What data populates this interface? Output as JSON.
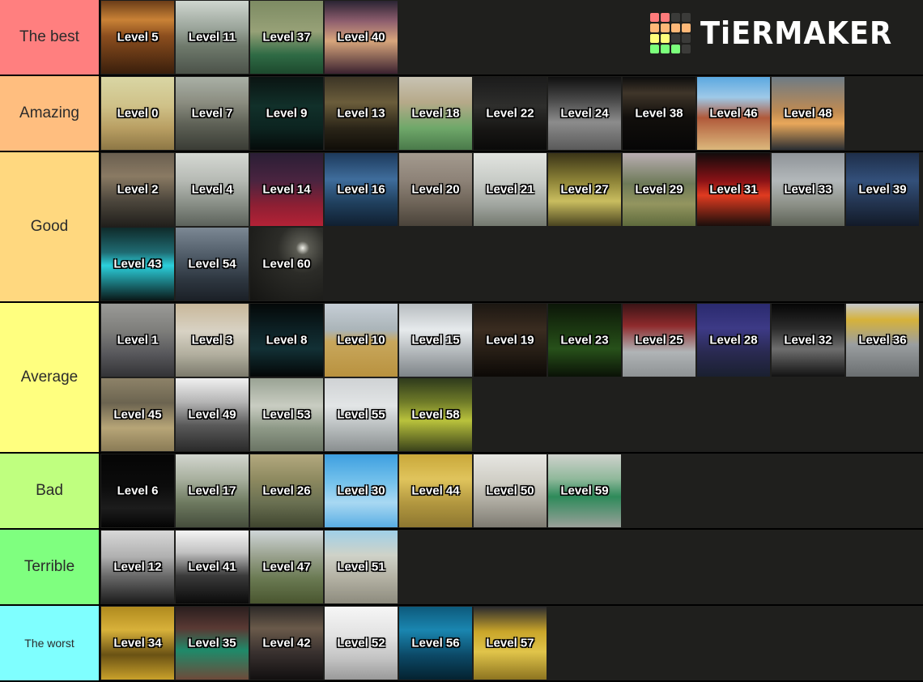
{
  "app": {
    "title": "TierMaker",
    "background_color": "#1f1f1d",
    "logo_text": "TiERMAKER"
  },
  "logo": {
    "cells": [
      "#ff7b7b",
      "#ff7b7b",
      "#3b3b39",
      "#3b3b39",
      "#ffb878",
      "#ffb878",
      "#ffb878",
      "#ffb878",
      "#ffff7b",
      "#ffff7b",
      "#3b3b39",
      "#3b3b39",
      "#7bff7b",
      "#7bff7b",
      "#7bff7b",
      "#3b3b39"
    ]
  },
  "tiers": [
    {
      "label": "The best",
      "color": "#ff7f7f",
      "items": [
        {
          "caption": "Level 5",
          "art": "lobby-warm-wood"
        },
        {
          "caption": "Level 11",
          "art": "empty-city-street"
        },
        {
          "caption": "Level 37",
          "art": "green-pool-room"
        },
        {
          "caption": "Level 40",
          "art": "arcade-cabinets"
        }
      ]
    },
    {
      "label": "Amazing",
      "color": "#ffbe7f",
      "items": [
        {
          "caption": "Level 0",
          "art": "yellow-carpet-rooms"
        },
        {
          "caption": "Level 7",
          "art": "flooded-thrift-store"
        },
        {
          "caption": "Level 9",
          "art": "dark-suburb-night"
        },
        {
          "caption": "Level 13",
          "art": "dim-tunnel-lights"
        },
        {
          "caption": "Level 18",
          "art": "colorful-classroom"
        },
        {
          "caption": "Level 22",
          "art": "dark-warehouse"
        },
        {
          "caption": "Level 24",
          "art": "grey-rocky-surface"
        },
        {
          "caption": "Level 38",
          "art": "dark-window-room"
        },
        {
          "caption": "Level 46",
          "art": "red-desert-arch"
        },
        {
          "caption": "Level 48",
          "art": "ocean-sunset"
        }
      ]
    },
    {
      "label": "Good",
      "color": "#ffd87f",
      "items": [
        {
          "caption": "Level 2",
          "art": "pipe-maintenance-hall"
        },
        {
          "caption": "Level 4",
          "art": "grey-office-floor"
        },
        {
          "caption": "Level 14",
          "art": "red-forest"
        },
        {
          "caption": "Level 16",
          "art": "blue-night-sky"
        },
        {
          "caption": "Level 20",
          "art": "warehouse-shelves"
        },
        {
          "caption": "Level 21",
          "art": "white-corridor-stairs"
        },
        {
          "caption": "Level 27",
          "art": "yellow-cave"
        },
        {
          "caption": "Level 29",
          "art": "country-road-trees"
        },
        {
          "caption": "Level 31",
          "art": "neon-red-club"
        },
        {
          "caption": "Level 33",
          "art": "mall-escalator"
        },
        {
          "caption": "Level 39",
          "art": "blue-dusk-woods"
        },
        {
          "caption": "Level 43",
          "art": "cyan-screen-warehouse"
        },
        {
          "caption": "Level 54",
          "art": "concrete-stairwell"
        },
        {
          "caption": "Level 60",
          "art": "dark-void-lights"
        }
      ]
    },
    {
      "label": "Average",
      "color": "#ffff7f",
      "items": [
        {
          "caption": "Level 1",
          "art": "grey-parking-garage"
        },
        {
          "caption": "Level 3",
          "art": "white-cage-corridor"
        },
        {
          "caption": "Level 8",
          "art": "black-cave-teal"
        },
        {
          "caption": "Level 10",
          "art": "wheat-field-sky"
        },
        {
          "caption": "Level 15",
          "art": "white-tiled-tunnel"
        },
        {
          "caption": "Level 19",
          "art": "dark-wooden-attic"
        },
        {
          "caption": "Level 23",
          "art": "green-night-forest"
        },
        {
          "caption": "Level 25",
          "art": "red-arcade-interior"
        },
        {
          "caption": "Level 28",
          "art": "purple-night-ruin"
        },
        {
          "caption": "Level 32",
          "art": "bw-forest-figures"
        },
        {
          "caption": "Level 36",
          "art": "airport-terminal"
        },
        {
          "caption": "Level 45",
          "art": "tan-office-desk"
        },
        {
          "caption": "Level 49",
          "art": "bw-battlefield"
        },
        {
          "caption": "Level 53",
          "art": "green-kitchen"
        },
        {
          "caption": "Level 55",
          "art": "supermarket-aisle"
        },
        {
          "caption": "Level 58",
          "art": "yellow-factory"
        }
      ]
    },
    {
      "label": "Bad",
      "color": "#bfff7f",
      "items": [
        {
          "caption": "Level 6",
          "art": "pitch-black-room"
        },
        {
          "caption": "Level 17",
          "art": "green-door-hallway"
        },
        {
          "caption": "Level 26",
          "art": "patterned-hotel-hall"
        },
        {
          "caption": "Level 30",
          "art": "blue-sky-clouds"
        },
        {
          "caption": "Level 44",
          "art": "yellow-tile-room"
        },
        {
          "caption": "Level 50",
          "art": "foggy-desert-road"
        },
        {
          "caption": "Level 59",
          "art": "green-subway-tunnel"
        }
      ]
    },
    {
      "label": "Terrible",
      "color": "#7fff7f",
      "items": [
        {
          "caption": "Level 12",
          "art": "grey-test-pattern"
        },
        {
          "caption": "Level 41",
          "art": "bw-wooden-bridge"
        },
        {
          "caption": "Level 47",
          "art": "misty-forest-vines"
        },
        {
          "caption": "Level 51",
          "art": "skylight-stone-hall"
        }
      ]
    },
    {
      "label": "The worst",
      "color": "#7fffff",
      "items": [
        {
          "caption": "Level 34",
          "art": "golden-cave-arch"
        },
        {
          "caption": "Level 35",
          "art": "green-underpass"
        },
        {
          "caption": "Level 42",
          "art": "smoky-dark-sky"
        },
        {
          "caption": "Level 52",
          "art": "snowy-white-forest"
        },
        {
          "caption": "Level 56",
          "art": "deep-blue-water"
        },
        {
          "caption": "Level 57",
          "art": "yellow-pool-ceiling"
        }
      ]
    }
  ]
}
